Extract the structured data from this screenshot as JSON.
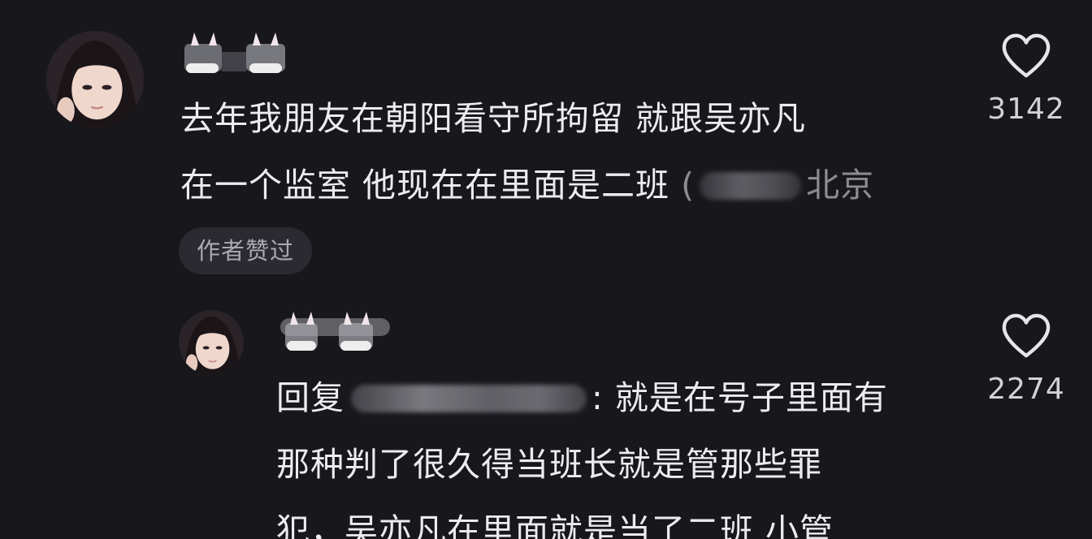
{
  "comments": [
    {
      "line1": "去年我朋友在朝阳看守所拘留 就跟吴亦凡",
      "line2": "在一个监室 他现在在里面是二班",
      "location_prefix": "(",
      "location": "北京",
      "author_badge": "作者赞过",
      "likes": "3142"
    },
    {
      "reply_prefix": "回复",
      "reply_suffix": ": 就是在号子里面有",
      "line2": "那种判了很久得当班长就是管那些罪",
      "line3": "犯，吴亦凡在里面就是当了二班 小管",
      "likes": "2274"
    }
  ],
  "icons": {
    "like": "heart-outline-icon",
    "avatar": "avatar-photo"
  },
  "colors": {
    "background": "#17171c",
    "text": "#ececee",
    "muted": "#8c8c92",
    "badge_bg": "#2a2a30"
  }
}
